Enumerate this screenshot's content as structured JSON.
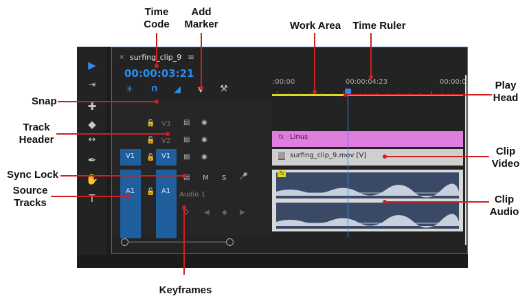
{
  "callouts": {
    "time_code": "Time\nCode",
    "add_marker": "Add\nMarker",
    "work_area": "Work Area",
    "time_ruler": "Time Ruler",
    "snap": "Snap",
    "play_head": "Play\nHead",
    "track_header": "Track\nHeader",
    "clip_video": "Clip\nVideo",
    "sync_lock": "Sync Lock",
    "source_tracks": "Source\nTracks",
    "clip_audio": "Clip\nAudio",
    "keyframes": "Keyframes"
  },
  "sequence": {
    "close_glyph": "×",
    "name": "surfing_clip_9",
    "menu_glyph": "≡",
    "timecode": "00:00:03:21"
  },
  "ruler": {
    "tick_0": ":00:00",
    "tick_1": "00:00:04:23",
    "tick_2": "00:00:0"
  },
  "tracks": {
    "v3": "V3",
    "v2": "V2",
    "v1_source": "V1",
    "v1": "V1",
    "a1_source": "A1",
    "a1": "A1",
    "m": "M",
    "s": "S",
    "audio_name": "Audio 1"
  },
  "clips": {
    "linus": "Linus",
    "fx": "fx",
    "video_clip": "surfing_clip_9.mov [V]"
  },
  "colors": {
    "accent_blue": "#2e8cf0",
    "linus_clip": "#e07ee0",
    "video_clip": "#cfcfcf",
    "audio_clip": "#3a4a66",
    "source_track": "#1f5f9e",
    "work_area_bar": "#e0d820",
    "play_head": "#2e8cf0"
  }
}
